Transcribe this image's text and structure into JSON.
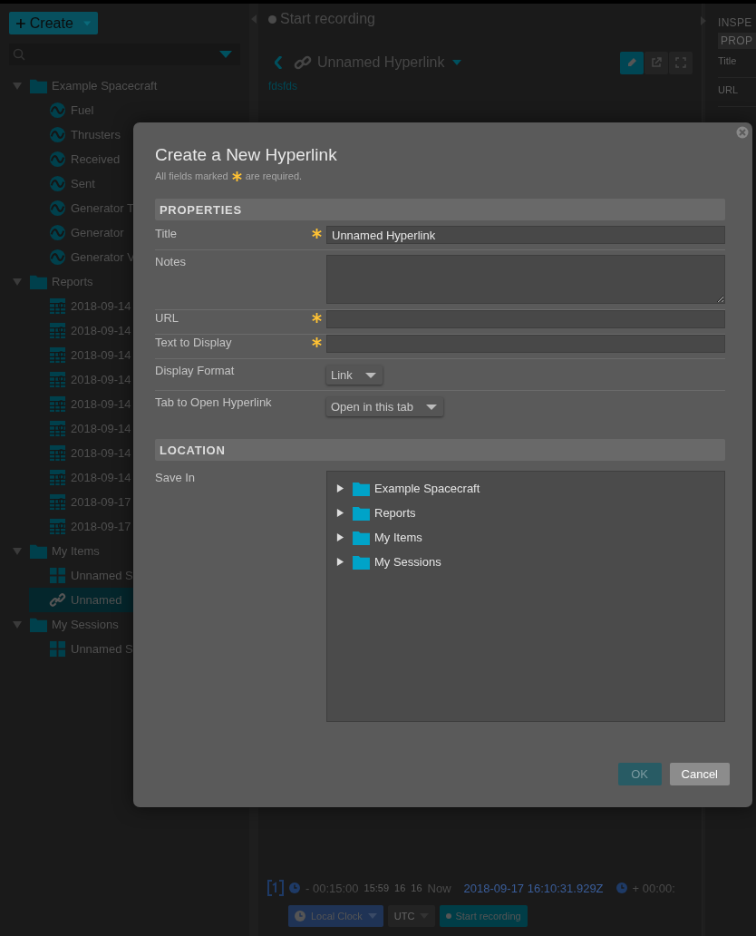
{
  "sidebar": {
    "create_button": "Create",
    "tree": [
      {
        "label": "Example Spacecraft",
        "kind": "folder",
        "expanded": true,
        "selected": false,
        "children": [
          {
            "label": "Fuel",
            "kind": "telemetry",
            "selected": false
          },
          {
            "label": "Thrusters",
            "kind": "telemetry",
            "selected": false
          },
          {
            "label": "Received",
            "kind": "telemetry",
            "selected": false
          },
          {
            "label": "Sent",
            "kind": "telemetry",
            "selected": false
          },
          {
            "label": "Generator T",
            "kind": "telemetry",
            "selected": false
          },
          {
            "label": "Generator",
            "kind": "telemetry",
            "selected": false
          },
          {
            "label": "Generator V",
            "kind": "telemetry",
            "selected": false
          }
        ]
      },
      {
        "label": "Reports",
        "kind": "folder",
        "expanded": true,
        "selected": false,
        "children": [
          {
            "label": "2018-09-14",
            "kind": "report",
            "selected": false
          },
          {
            "label": "2018-09-14",
            "kind": "report",
            "selected": false
          },
          {
            "label": "2018-09-14",
            "kind": "report",
            "selected": false
          },
          {
            "label": "2018-09-14",
            "kind": "report",
            "selected": false
          },
          {
            "label": "2018-09-14",
            "kind": "report",
            "selected": false
          },
          {
            "label": "2018-09-14",
            "kind": "report",
            "selected": false
          },
          {
            "label": "2018-09-14",
            "kind": "report",
            "selected": false
          },
          {
            "label": "2018-09-14",
            "kind": "report",
            "selected": false
          },
          {
            "label": "2018-09-17",
            "kind": "report",
            "selected": false
          },
          {
            "label": "2018-09-17",
            "kind": "report",
            "selected": false
          }
        ]
      },
      {
        "label": "My Items",
        "kind": "folder",
        "expanded": true,
        "selected": false,
        "children": [
          {
            "label": "Unnamed S",
            "kind": "layout",
            "selected": false
          },
          {
            "label": "Unnamed",
            "kind": "hyperlink",
            "selected": true
          }
        ]
      },
      {
        "label": "My Sessions",
        "kind": "folder",
        "expanded": true,
        "selected": false,
        "children": [
          {
            "label": "Unnamed S",
            "kind": "layout",
            "selected": false
          }
        ]
      }
    ]
  },
  "main": {
    "record_status": "Start recording",
    "object_title": "Unnamed Hyperlink",
    "toolbar": [
      {
        "kind": "edit",
        "selected": true
      },
      {
        "kind": "external",
        "selected": false
      },
      {
        "kind": "fullscreen",
        "selected": false
      }
    ],
    "link_text": "fdsfds",
    "time_conductor": {
      "start_offset": "- 00:15:00",
      "ticks": [
        "15:59",
        "16",
        "16"
      ],
      "now_label": "Now",
      "timestamp": "2018-09-17 16:10:31.929Z",
      "end_offset": "+ 00:00:",
      "clock": "Local Clock",
      "timezone": "UTC",
      "record_button": "Start recording"
    }
  },
  "inspector": {
    "heading": "INSPE",
    "tab": "PROP",
    "labels": [
      "Title",
      "URL"
    ]
  },
  "dialog": {
    "title": "Create a New Hyperlink",
    "note_before": "All fields marked",
    "note_after": "are required.",
    "sections": [
      {
        "heading": "PROPERTIES",
        "fields": [
          {
            "label": "Title",
            "kind": "text",
            "required": true,
            "value": "Unnamed Hyperlink"
          },
          {
            "label": "Notes",
            "kind": "textarea",
            "required": false
          },
          {
            "label": "URL",
            "kind": "text",
            "required": true
          },
          {
            "label": "Text to Display",
            "kind": "text",
            "required": true
          },
          {
            "label": "Display Format",
            "kind": "select",
            "required": false,
            "value": "Link"
          },
          {
            "label": "Tab to Open Hyperlink",
            "kind": "select",
            "required": false,
            "value": "Open in this tab"
          }
        ]
      },
      {
        "heading": "LOCATION",
        "fields": [
          {
            "label": "Save In",
            "kind": "tree",
            "required": false,
            "items": [
              {
                "label": "Example Spacecraft",
                "expanded": false
              },
              {
                "label": "Reports",
                "expanded": false
              },
              {
                "label": "My Items",
                "expanded": false
              },
              {
                "label": "My Sessions",
                "expanded": false
              }
            ]
          }
        ]
      }
    ],
    "buttons": [
      {
        "label": "OK",
        "kind": "primary",
        "disabled": true
      },
      {
        "label": "Cancel",
        "kind": "secondary",
        "disabled": false
      }
    ]
  }
}
